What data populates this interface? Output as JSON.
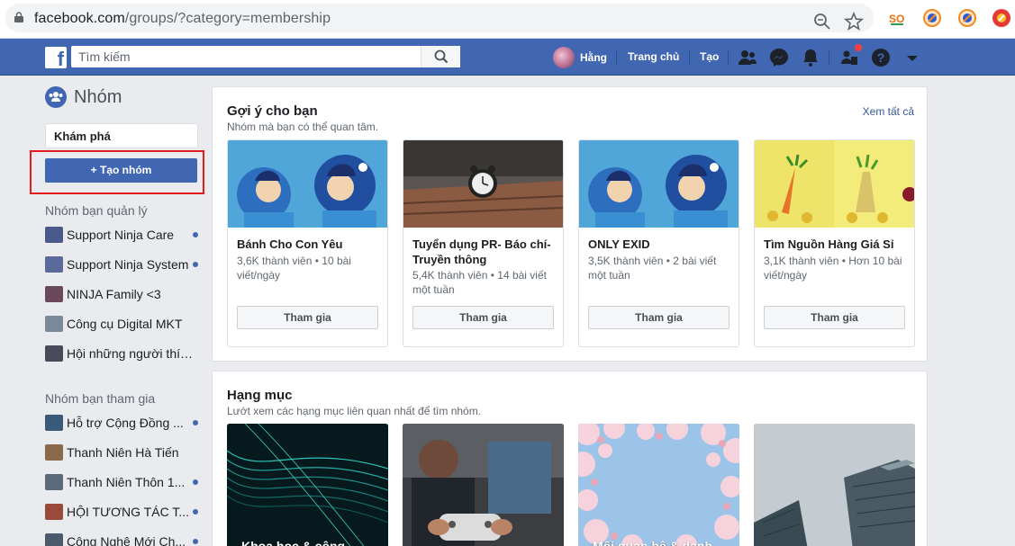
{
  "browser": {
    "url_domain": "facebook.com",
    "url_rest": "/groups/?category=membership",
    "icons": [
      "lock-icon",
      "zoom-icon",
      "star-icon"
    ],
    "extensions": [
      "so-extension-icon",
      "extension-icon-1",
      "extension-icon-2",
      "extension-icon-3"
    ]
  },
  "nav": {
    "search_placeholder": "Tìm kiếm",
    "user_name": "Hằng",
    "home": "Trang chủ",
    "create": "Tạo"
  },
  "sidebar": {
    "title": "Nhóm",
    "explore": "Khám phá",
    "create_group": "+ Tạo nhóm",
    "managed_heading": "Nhóm bạn quản lý",
    "managed": [
      {
        "label": "Support Ninja Care",
        "dot": true
      },
      {
        "label": "Support Ninja System",
        "dot": true
      },
      {
        "label": "NINJA Family <3",
        "dot": false
      },
      {
        "label": "Công cụ Digital MKT",
        "dot": false
      },
      {
        "label": "Hội những người thích...",
        "dot": false
      }
    ],
    "joined_heading": "Nhóm bạn tham gia",
    "joined": [
      {
        "label": "Hỗ trợ Cộng Đồng ...",
        "dot": true
      },
      {
        "label": "Thanh Niên Hà Tiến",
        "dot": false
      },
      {
        "label": "Thanh Niên Thôn 1...",
        "dot": true
      },
      {
        "label": "HỘI TƯƠNG TÁC T...",
        "dot": true
      },
      {
        "label": "Công Nghệ Mới Ch...",
        "dot": true
      }
    ]
  },
  "suggestions": {
    "title": "Gợi ý cho bạn",
    "subtitle": "Nhóm mà bạn có thể quan tâm.",
    "see_all": "Xem tất cả",
    "cards": [
      {
        "name": "Bánh Cho Con Yêu",
        "meta": "3,6K thành viên • 10 bài viết/ngày",
        "join": "Tham gia"
      },
      {
        "name": "Tuyển dụng PR- Báo chí- Truyền thông",
        "meta": "5,4K thành viên • 14 bài viết một tuần",
        "join": "Tham gia"
      },
      {
        "name": "ONLY EXID",
        "meta": "3,5K thành viên • 2 bài viết một tuần",
        "join": "Tham gia"
      },
      {
        "name": "Tìm Nguồn Hàng Giá Sỉ",
        "meta": "3,1K thành viên • Hơn 10 bài viết/ngày",
        "join": "Tham gia"
      }
    ]
  },
  "categories": {
    "title": "Hạng mục",
    "subtitle": "Lướt xem các hạng mục liên quan nhất để tìm nhóm.",
    "items": [
      {
        "label": "Khoa học & công"
      },
      {
        "label": ""
      },
      {
        "label": "Mối quan hệ & danh"
      },
      {
        "label": ""
      }
    ]
  },
  "colors": {
    "fb_blue": "#4267b2",
    "highlight_red": "#e41b1b",
    "link": "#365899"
  }
}
